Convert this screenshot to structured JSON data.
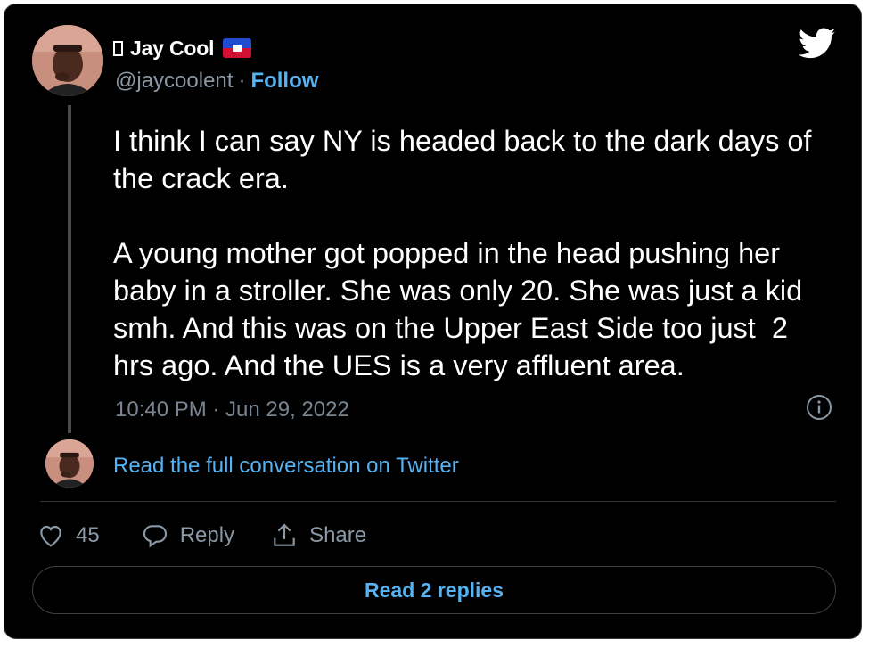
{
  "author": {
    "display_name": "Jay Cool",
    "handle": "@jaycoolent",
    "separator": "·",
    "follow_label": "Follow",
    "flag_icon": "haiti-flag-icon",
    "avatar_icon": "user-avatar"
  },
  "brand": {
    "icon": "twitter-bird-icon",
    "accent": "#1d9bf0"
  },
  "tweet": {
    "text": "I think I can say NY is headed back to the dark days of the crack era.\n\nA young mother got popped in the head pushing her baby in a stroller. She was only 20. She was just a kid  smh. And this was on the Upper East Side too just  2 hrs ago. And the UES is a very affluent area.",
    "timestamp": "10:40 PM · Jun 29, 2022"
  },
  "conversation": {
    "link_label": "Read the full conversation on Twitter"
  },
  "actions": {
    "like_count": "45",
    "reply_label": "Reply",
    "share_label": "Share"
  },
  "footer": {
    "read_replies_label": "Read 2 replies"
  },
  "colors": {
    "background": "#000000",
    "link": "#56b3f3",
    "muted": "#8b98a5",
    "text": "#ffffff"
  }
}
